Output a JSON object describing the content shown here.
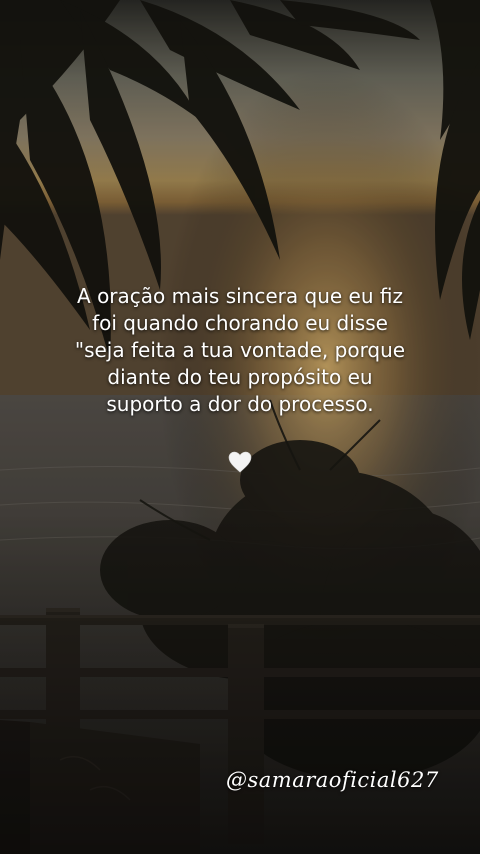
{
  "post": {
    "quote_lines": [
      "A oração mais sincera que eu fiz",
      "foi quando chorando eu disse",
      "\"seja feita a tua vontade, porque",
      "diante do teu propósito eu",
      "suporto a dor do processo."
    ],
    "heart_icon": "white-heart-icon",
    "signature": "@samaraoficial627"
  },
  "colors": {
    "text": "#ffffff",
    "sky_glow": "#b08a4a",
    "sea": "#4a4a44",
    "foliage": "#14130f"
  }
}
